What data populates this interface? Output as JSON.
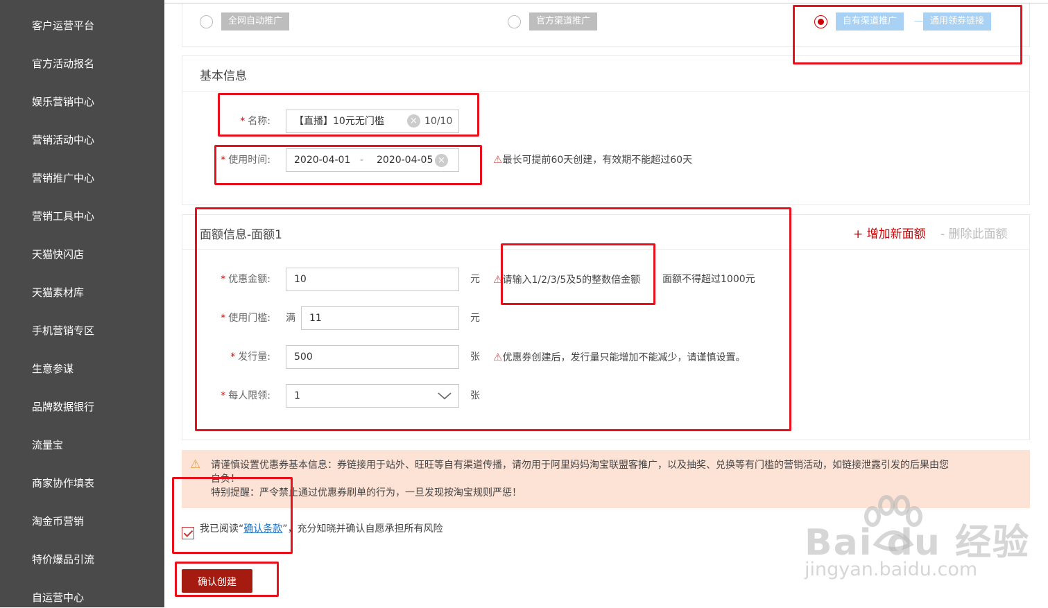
{
  "sidebar": {
    "items": [
      "客户运营平台",
      "官方活动报名",
      "娱乐营销中心",
      "营销活动中心",
      "营销推广中心",
      "营销工具中心",
      "天猫快闪店",
      "天猫素材库",
      "手机营销专区",
      "生意参谋",
      "品牌数据银行",
      "流量宝",
      "商家协作填表",
      "淘金币营销",
      "特价爆品引流",
      "自运营中心"
    ]
  },
  "promo_options": {
    "option1": "全网自动推广",
    "option2": "官方渠道推广",
    "option3": "自有渠道推广",
    "option3_sub": "通用领券链接",
    "separator": "—"
  },
  "basic_info": {
    "title": "基本信息",
    "name_label": "名称:",
    "name_value": "【直播】10元无门槛",
    "name_count": "10/10",
    "time_label": "使用时间:",
    "time_start": "2020-04-01",
    "time_sep": "-",
    "time_end": "2020-04-05",
    "time_hint": "最长可提前60天创建，有效期不能超过60天"
  },
  "face_info": {
    "title": "面额信息-面额1",
    "add_label": "+ 增加新面额",
    "delete_label": "- 删除此面额",
    "amount_label": "优惠金额:",
    "amount_value": "10",
    "amount_unit": "元",
    "amount_hint": "请输入1/2/3/5及5的整数倍金额",
    "amount_hint2": "面额不得超过1000元",
    "threshold_label": "使用门槛:",
    "threshold_prefix": "满",
    "threshold_value": "11",
    "threshold_unit": "元",
    "issue_label": "发行量:",
    "issue_value": "500",
    "issue_unit": "张",
    "issue_hint": "优惠券创建后，发行量只能增加不能减少，请谨慎设置。",
    "limit_label": "每人限领:",
    "limit_value": "1",
    "limit_unit": "张"
  },
  "notice": {
    "line1": "请谨慎设置优惠券基本信息：券链接用于站外、旺旺等自有渠道传播，请勿用于阿里妈妈淘宝联盟客推广，以及抽奖、兑换等有门槛的营销活动，如链接泄露引发的后果由您",
    "line1b": "自负！",
    "line2": "特别提醒：严令禁止通过优惠券刷单的行为，一旦发现按淘宝规则严惩！"
  },
  "agree": {
    "prefix": "我已阅读“",
    "link": "确认条款",
    "suffix": "”，充分知晓并确认自愿承担所有风险"
  },
  "confirm_button": "确认创建",
  "watermark": {
    "brand": "Bai du 经验",
    "url": "jingyan.baidu.com"
  },
  "colors": {
    "sidebar_bg": "#4a4a4a",
    "accent_red": "#c00000",
    "button_red": "#a51b10",
    "tag_blue": "#a8d1f3",
    "tag_gray": "#bdbdbd",
    "notice_bg": "#fde3d6",
    "annotation_red": "#e8101a"
  }
}
